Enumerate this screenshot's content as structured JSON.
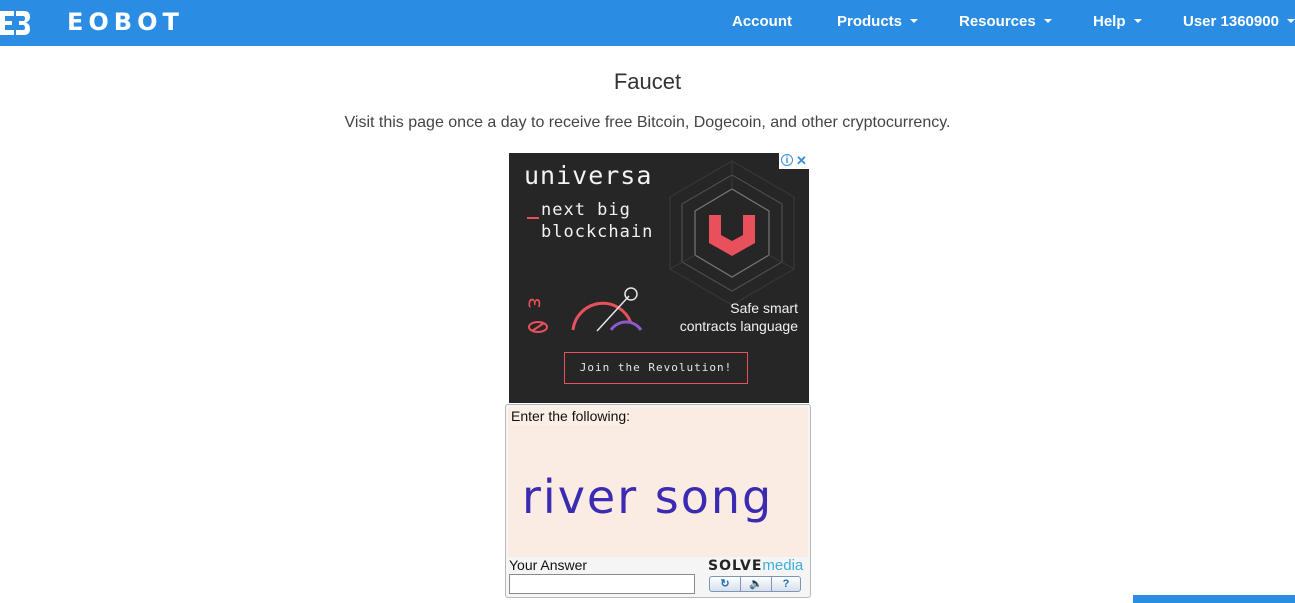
{
  "navbar": {
    "logo_text": "EOBOT",
    "items": [
      {
        "label": "Account",
        "dropdown": false
      },
      {
        "label": "Products",
        "dropdown": true
      },
      {
        "label": "Resources",
        "dropdown": true
      },
      {
        "label": "Help",
        "dropdown": true
      },
      {
        "label": "User 1360900",
        "dropdown": true
      }
    ],
    "color": "#2a8de3"
  },
  "page": {
    "title": "Faucet",
    "subtitle": "Visit this page once a day to receive free Bitcoin, Dogecoin, and other cryptocurrency."
  },
  "ad": {
    "brand": "universa",
    "tagline_line1": "next big",
    "tagline_line2": "blockchain",
    "side_line1": "Safe smart",
    "side_line2": "contracts language",
    "cta": "Join the Revolution!",
    "accent": "#e8505b",
    "background": "#262626"
  },
  "captcha": {
    "instruction": "Enter the following:",
    "words": "river song",
    "answer_label": "Your Answer",
    "answer_value": "",
    "provider_part1": "SOLVE",
    "provider_part2": "media",
    "buttons": [
      {
        "icon": "refresh-icon",
        "glyph": "↻"
      },
      {
        "icon": "audio-icon",
        "glyph": "🔈"
      },
      {
        "icon": "help-icon",
        "glyph": "?"
      }
    ]
  }
}
